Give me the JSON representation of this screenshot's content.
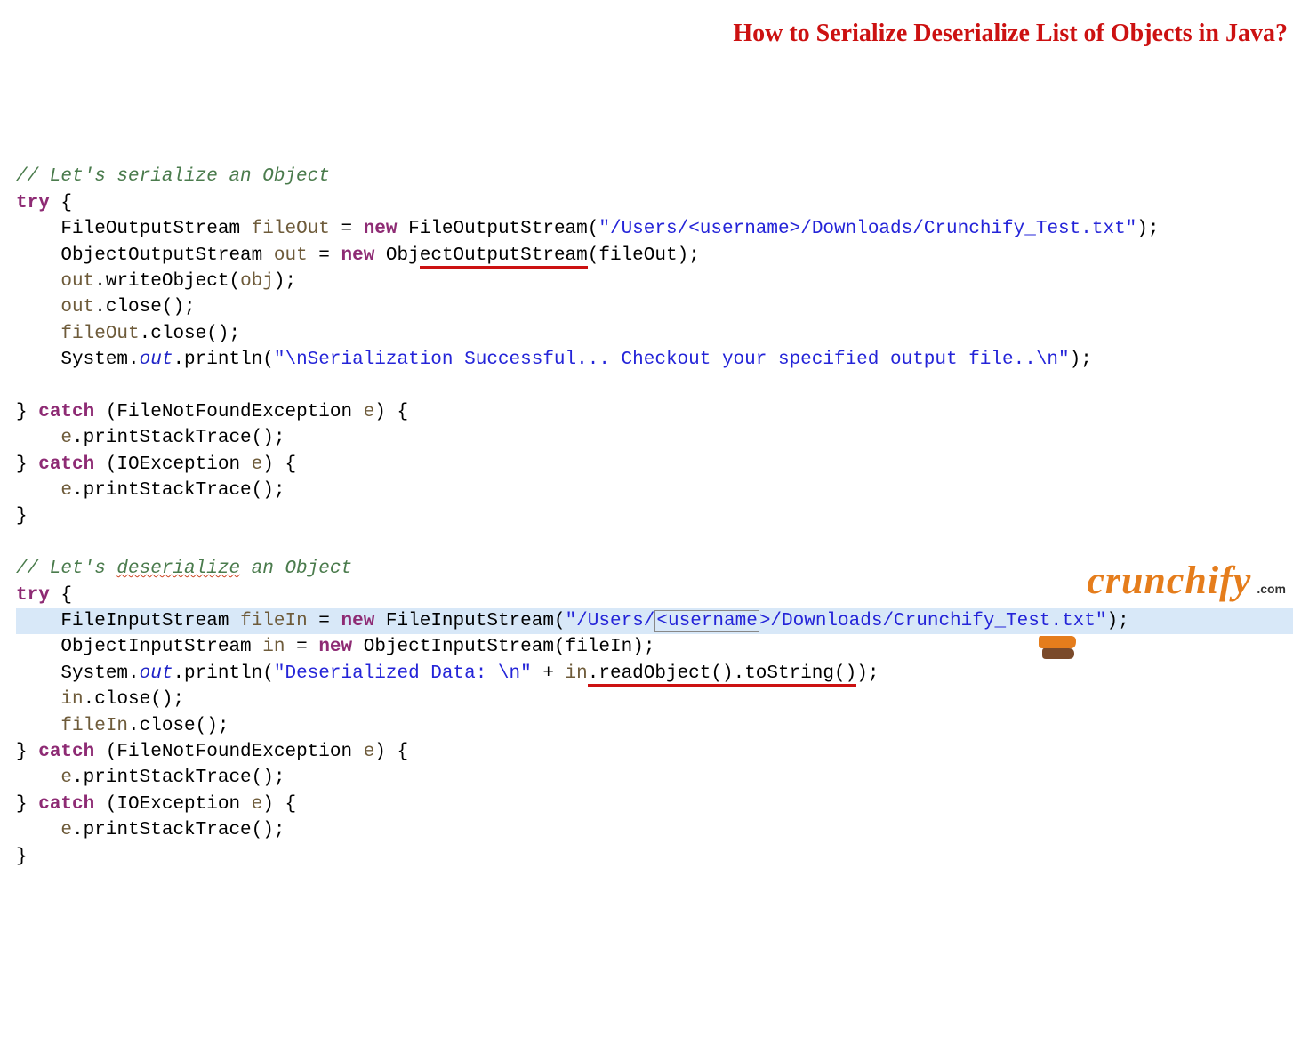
{
  "title": "How to Serialize Deserialize List of Objects in Java?",
  "code": {
    "c1": "// Let's serialize an Object",
    "try": "try",
    "lbr": " {",
    "type_fos": "FileOutputStream",
    "v_fileOut": "fileOut",
    "eq": " = ",
    "kw_new": "new",
    "sp": " ",
    "str_path": "\"/Users/<username>/Downloads/Crunchify_Test.txt\"",
    "semi": ";",
    "type_oos": "ObjectOutputStream",
    "v_out": "out",
    "arg_fileOut": "(fileOut)",
    "l_writeObj": ".writeObject(",
    "v_obj": "obj",
    "rpar": ")",
    "l_close": ".close();",
    "sys": "System.",
    "s_out": "out",
    "println": ".println(",
    "str_serial": "\"\\nSerialization Successful... Checkout your specified output file..\\n\"",
    "rb": "}",
    "catch": " catch ",
    "ex_fnf": "(FileNotFoundException ",
    "v_e": "e",
    "rpar_lbr": ") {",
    "pst": ".printStackTrace();",
    "ex_io": "(IOException ",
    "c2a": "// Let's ",
    "c2b": "deserialize",
    "c2c": " an Object",
    "type_fis": "FileInputStream",
    "v_fileIn": "fileIn",
    "str_path2a": "\"/Users/",
    "str_path2b": "<username",
    "str_path2c": ">",
    "str_path2d": "/Downloads/Crunchify_Test.txt\"",
    "type_ois": "ObjectInputStream",
    "v_in": "in",
    "arg_fileIn": "(fileIn)",
    "str_deser": "\"Deserialized Data: \\n\"",
    "plus": " + ",
    "readobj": ".readObject().toString()",
    "rparsemi": ");"
  },
  "logo": {
    "name": "crunchify",
    "tld": ".com"
  }
}
